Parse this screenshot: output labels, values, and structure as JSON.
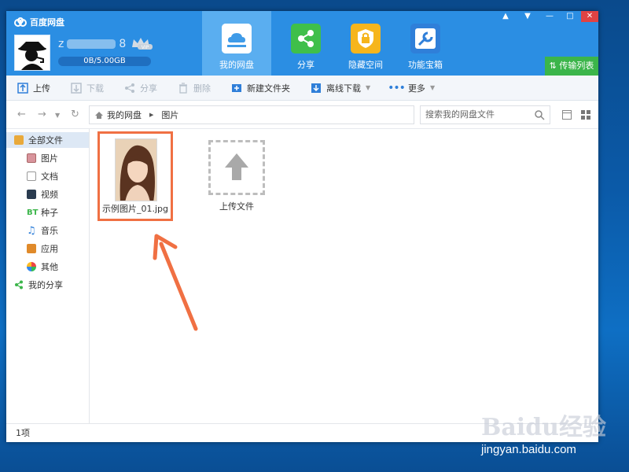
{
  "app": {
    "title": "百度网盘"
  },
  "user": {
    "name_prefix": "z",
    "name_suffix": "8",
    "vip_badge": "VIP",
    "quota": "0B/5.00GB"
  },
  "nav_tabs": [
    {
      "label": "我的网盘",
      "active": true
    },
    {
      "label": "分享"
    },
    {
      "label": "隐藏空间"
    },
    {
      "label": "功能宝箱"
    }
  ],
  "transfer_list": "传输列表",
  "toolbar": {
    "upload": "上传",
    "download": "下载",
    "share": "分享",
    "delete": "删除",
    "new_folder": "新建文件夹",
    "offline_download": "离线下载",
    "more": "更多"
  },
  "breadcrumb": {
    "root": "我的网盘",
    "current": "图片"
  },
  "search": {
    "placeholder": "搜索我的网盘文件"
  },
  "sidebar": {
    "items": [
      {
        "label": "全部文件",
        "active": true
      },
      {
        "label": "图片"
      },
      {
        "label": "文档"
      },
      {
        "label": "视频"
      },
      {
        "label": "种子"
      },
      {
        "label": "音乐"
      },
      {
        "label": "应用"
      },
      {
        "label": "其他"
      },
      {
        "label": "我的分享"
      }
    ]
  },
  "files": [
    {
      "name": "示例图片_01.jpg"
    }
  ],
  "upload_placeholder": "上传文件",
  "status": {
    "count": "1项"
  },
  "watermark": {
    "logo": "Baidu经验",
    "url": "jingyan.baidu.com"
  },
  "colors": {
    "header": "#2b8ee3",
    "active_tab": "#5aaef0",
    "transfer": "#3bb54a",
    "highlight": "#f07043"
  }
}
